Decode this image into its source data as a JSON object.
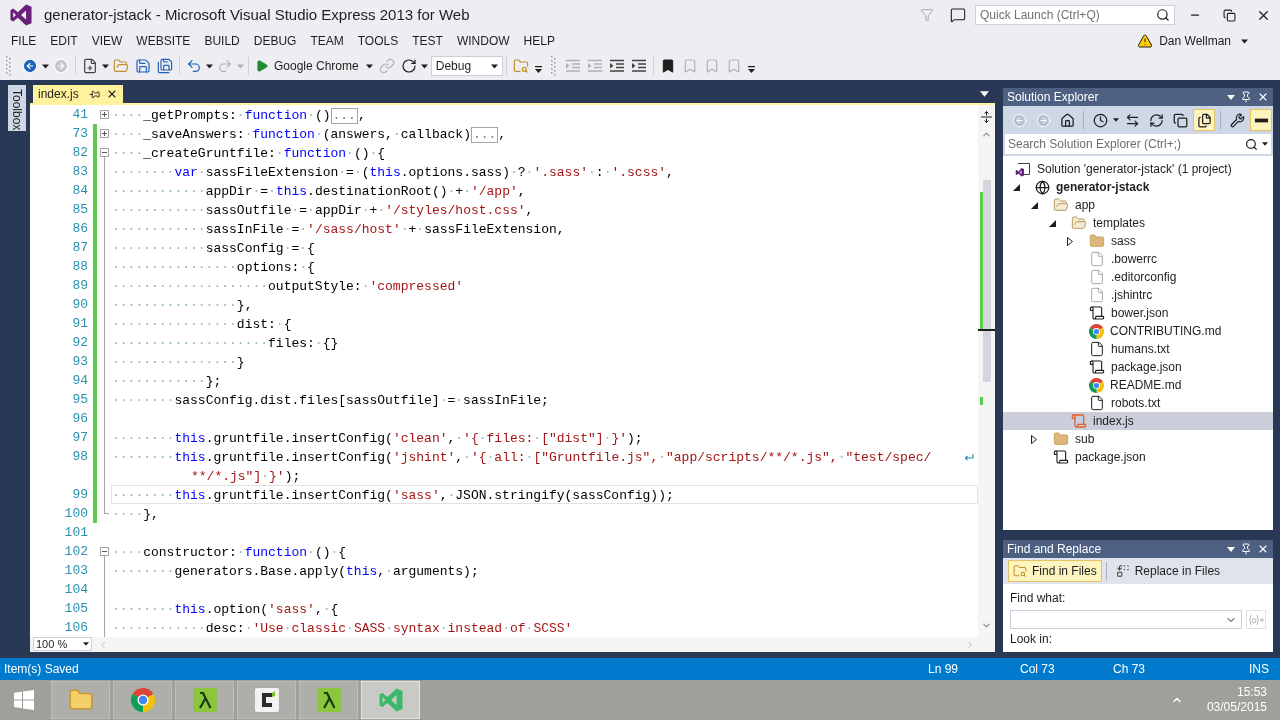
{
  "window": {
    "title": "generator-jstack - Microsoft Visual Studio Express 2013 for Web",
    "quick_launch": {
      "placeholder": "Quick Launch (Ctrl+Q)"
    }
  },
  "menu": [
    "FILE",
    "EDIT",
    "VIEW",
    "WEBSITE",
    "BUILD",
    "DEBUG",
    "TEAM",
    "TOOLS",
    "TEST",
    "WINDOW",
    "HELP"
  ],
  "account": {
    "name": "Dan Wellman",
    "warning": true
  },
  "toolbar": [
    {
      "kind": "back",
      "disabled": false
    },
    {
      "kind": "forward",
      "disabled": true
    },
    {
      "kind": "new-project",
      "disabled": false
    },
    {
      "kind": "open",
      "disabled": false
    },
    {
      "kind": "save",
      "disabled": false
    },
    {
      "kind": "save-all",
      "disabled": false
    },
    {
      "kind": "undo",
      "disabled": false
    },
    {
      "kind": "redo",
      "disabled": true
    },
    {
      "kind": "run",
      "label": "Google Chrome"
    },
    {
      "kind": "browser-link",
      "disabled": true
    },
    {
      "kind": "refresh",
      "disabled": false
    },
    {
      "kind": "select",
      "value": "Debug"
    },
    {
      "kind": "find-in-files",
      "disabled": false
    },
    {
      "kind": "indent-less",
      "disabled": true
    },
    {
      "kind": "indent-more",
      "disabled": true
    },
    {
      "kind": "comment",
      "disabled": false
    },
    {
      "kind": "uncomment",
      "disabled": false
    },
    {
      "kind": "bookmark",
      "disabled": false
    },
    {
      "kind": "bookmark-prev",
      "disabled": true
    },
    {
      "kind": "bookmark-next",
      "disabled": true
    },
    {
      "kind": "bookmark-clear",
      "disabled": true
    }
  ],
  "toolbox": {
    "label": "Toolbox"
  },
  "editor": {
    "tab": {
      "label": "index.js",
      "selected": true
    },
    "lines": [
      {
        "number": "41",
        "expanded": false,
        "changed": false,
        "current": false,
        "tokens": [
          {
            "kind": "plain",
            "text": "····_getPrompts:·"
          },
          {
            "kind": "keyword",
            "text": "function"
          },
          {
            "kind": "plain",
            "text": "·()"
          },
          {
            "kind": "collapsed",
            "text": "..."
          },
          {
            "kind": "plain",
            "text": ","
          }
        ]
      },
      {
        "number": "73",
        "expanded": false,
        "changed": true,
        "current": false,
        "tokens": [
          {
            "kind": "plain",
            "text": "····_saveAnswers:·"
          },
          {
            "kind": "keyword",
            "text": "function"
          },
          {
            "kind": "plain",
            "text": "·(answers,·callback)"
          },
          {
            "kind": "collapsed",
            "text": "..."
          },
          {
            "kind": "plain",
            "text": ","
          }
        ]
      },
      {
        "number": "82",
        "expanded": true,
        "changed": true,
        "current": false,
        "tokens": [
          {
            "kind": "plain",
            "text": "····_createGruntfile:·"
          },
          {
            "kind": "keyword",
            "text": "function"
          },
          {
            "kind": "plain",
            "text": "·()·{"
          }
        ],
        "children": [
          {
            "number": "83",
            "changed": true,
            "current": false,
            "tokens": [
              {
                "kind": "plain",
                "text": "········"
              },
              {
                "kind": "keyword",
                "text": "var"
              },
              {
                "kind": "plain",
                "text": "·sassFileExtension·=·("
              },
              {
                "kind": "keyword",
                "text": "this"
              },
              {
                "kind": "plain",
                "text": ".options.sass)·?·"
              },
              {
                "kind": "string",
                "text": "'.sass'"
              },
              {
                "kind": "plain",
                "text": "·:·"
              },
              {
                "kind": "string",
                "text": "'.scss'"
              },
              {
                "kind": "plain",
                "text": ","
              }
            ]
          },
          {
            "number": "84",
            "changed": true,
            "current": false,
            "tokens": [
              {
                "kind": "plain",
                "text": "············appDir·=·"
              },
              {
                "kind": "keyword",
                "text": "this"
              },
              {
                "kind": "plain",
                "text": ".destinationRoot()·+·"
              },
              {
                "kind": "string",
                "text": "'/app'"
              },
              {
                "kind": "plain",
                "text": ","
              }
            ]
          },
          {
            "number": "85",
            "changed": true,
            "current": false,
            "tokens": [
              {
                "kind": "plain",
                "text": "············sassOutfile·=·appDir·+·"
              },
              {
                "kind": "string",
                "text": "'/styles/host.css'"
              },
              {
                "kind": "plain",
                "text": ","
              }
            ]
          },
          {
            "number": "86",
            "changed": true,
            "current": false,
            "tokens": [
              {
                "kind": "plain",
                "text": "············sassInFile·=·"
              },
              {
                "kind": "string",
                "text": "'/sass/host'"
              },
              {
                "kind": "plain",
                "text": "·+·sassFileExtension,"
              }
            ]
          },
          {
            "number": "87",
            "changed": true,
            "current": false,
            "tokens": [
              {
                "kind": "plain",
                "text": "············sassConfig·=·{"
              }
            ]
          },
          {
            "number": "88",
            "changed": true,
            "current": false,
            "tokens": [
              {
                "kind": "plain",
                "text": "················options:·{"
              }
            ]
          },
          {
            "number": "89",
            "changed": true,
            "current": false,
            "tokens": [
              {
                "kind": "plain",
                "text": "····················outputStyle:·"
              },
              {
                "kind": "string",
                "text": "'compressed'"
              }
            ]
          },
          {
            "number": "90",
            "changed": true,
            "current": false,
            "tokens": [
              {
                "kind": "plain",
                "text": "················},"
              }
            ]
          },
          {
            "number": "91",
            "changed": true,
            "current": false,
            "tokens": [
              {
                "kind": "plain",
                "text": "················dist:·{"
              }
            ]
          },
          {
            "number": "92",
            "changed": true,
            "current": false,
            "tokens": [
              {
                "kind": "plain",
                "text": "····················files:·{}"
              }
            ]
          },
          {
            "number": "93",
            "changed": true,
            "current": false,
            "tokens": [
              {
                "kind": "plain",
                "text": "················}"
              }
            ]
          },
          {
            "number": "94",
            "changed": true,
            "current": false,
            "tokens": [
              {
                "kind": "plain",
                "text": "············};"
              }
            ]
          },
          {
            "number": "95",
            "changed": true,
            "current": false,
            "tokens": [
              {
                "kind": "plain",
                "text": "········sassConfig.dist.files[sassOutfile]·=·sassInFile;"
              }
            ]
          },
          {
            "number": "96",
            "changed": true,
            "current": false
          },
          {
            "number": "97",
            "changed": true,
            "current": false,
            "tokens": [
              {
                "kind": "plain",
                "text": "········"
              },
              {
                "kind": "keyword",
                "text": "this"
              },
              {
                "kind": "plain",
                "text": ".gruntfile.insertConfig("
              },
              {
                "kind": "string",
                "text": "'clean'"
              },
              {
                "kind": "plain",
                "text": ",·"
              },
              {
                "kind": "string",
                "text": "'{·files:·[\"dist\"]·}'"
              },
              {
                "kind": "plain",
                "text": ");"
              }
            ]
          },
          {
            "number": "98",
            "changed": true,
            "current": false,
            "tokens": [
              {
                "kind": "plain",
                "text": "········"
              },
              {
                "kind": "keyword",
                "text": "this"
              },
              {
                "kind": "plain",
                "text": ".gruntfile.insertConfig("
              },
              {
                "kind": "string",
                "text": "'jshint'"
              },
              {
                "kind": "plain",
                "text": ",·"
              },
              {
                "kind": "string",
                "text": "'{·all:·[\"Gruntfile.js\",·\"app/scripts/**/*.js\",·\"test/spec/"
              }
            ],
            "wrap": [
              {
                "kind": "string",
                "text": "**/*.js\"]·}'"
              },
              {
                "kind": "plain",
                "text": ");"
              }
            ]
          },
          {
            "number": "99",
            "changed": true,
            "current": true,
            "tokens": [
              {
                "kind": "plain",
                "text": "········"
              },
              {
                "kind": "keyword",
                "text": "this"
              },
              {
                "kind": "plain",
                "text": ".gruntfile.insertConfig("
              },
              {
                "kind": "string",
                "text": "'sass'"
              },
              {
                "kind": "plain",
                "text": ",·JSON.stringify(sassConfig));"
              }
            ]
          },
          {
            "number": "100",
            "changed": true,
            "current": false,
            "tokens": [
              {
                "kind": "plain",
                "text": "····},"
              }
            ]
          }
        ]
      },
      {
        "number": "101",
        "changed": false,
        "current": false
      },
      {
        "number": "102",
        "expanded": true,
        "changed": false,
        "current": false,
        "tokens": [
          {
            "kind": "plain",
            "text": "····constructor:·"
          },
          {
            "kind": "keyword",
            "text": "function"
          },
          {
            "kind": "plain",
            "text": "·()·{"
          }
        ],
        "children": [
          {
            "number": "103",
            "changed": false,
            "current": false,
            "tokens": [
              {
                "kind": "plain",
                "text": "········generators.Base.apply("
              },
              {
                "kind": "keyword",
                "text": "this"
              },
              {
                "kind": "plain",
                "text": ",·arguments);"
              }
            ]
          },
          {
            "number": "104",
            "changed": false,
            "current": false
          },
          {
            "number": "105",
            "changed": false,
            "current": false,
            "tokens": [
              {
                "kind": "plain",
                "text": "········"
              },
              {
                "kind": "keyword",
                "text": "this"
              },
              {
                "kind": "plain",
                "text": ".option("
              },
              {
                "kind": "string",
                "text": "'sass'"
              },
              {
                "kind": "plain",
                "text": ",·{"
              }
            ]
          },
          {
            "number": "106",
            "changed": false,
            "current": false,
            "tokens": [
              {
                "kind": "plain",
                "text": "············desc:·"
              },
              {
                "kind": "string",
                "text": "'Use·classic·SASS·syntax·instead·of·SCSS'"
              }
            ]
          }
        ]
      }
    ],
    "zoom": "100 %"
  },
  "solution_explorer": {
    "title": "Solution Explorer",
    "toolbar": [
      {
        "kind": "back",
        "disabled": true,
        "pressed": false
      },
      {
        "kind": "forward",
        "disabled": true,
        "pressed": false
      },
      {
        "kind": "home",
        "disabled": false,
        "pressed": false
      },
      {
        "kind": "pending-changes",
        "disabled": false,
        "pressed": false
      },
      {
        "kind": "sync",
        "disabled": false,
        "pressed": false
      },
      {
        "kind": "refresh",
        "disabled": false,
        "pressed": false
      },
      {
        "kind": "collapse-all",
        "disabled": false,
        "pressed": false
      },
      {
        "kind": "show-all-files",
        "disabled": false,
        "pressed": true
      },
      {
        "kind": "properties",
        "disabled": false,
        "pressed": false
      },
      {
        "kind": "preview",
        "disabled": false,
        "pressed": true
      }
    ],
    "search": {
      "placeholder": "Search Solution Explorer (Ctrl+;)"
    },
    "tree": [
      {
        "label": "Solution 'generator-jstack' (1 project)",
        "kind": "solution",
        "selected": false,
        "children": [
          {
            "label": "generator-jstack",
            "kind": "project",
            "expanded": true,
            "selected": false,
            "children": [
              {
                "label": "app",
                "kind": "folder",
                "expanded": true,
                "selected": false,
                "children": [
                  {
                    "label": "templates",
                    "kind": "folder",
                    "expanded": true,
                    "selected": false,
                    "children": [
                      {
                        "label": "sass",
                        "kind": "folder",
                        "expanded": false,
                        "selected": false
                      },
                      {
                        "label": ".bowerrc",
                        "kind": "file",
                        "selected": false
                      },
                      {
                        "label": ".editorconfig",
                        "kind": "file",
                        "selected": false
                      },
                      {
                        "label": ".jshintrc",
                        "kind": "file",
                        "selected": false
                      },
                      {
                        "label": "bower.json",
                        "kind": "json",
                        "selected": false
                      },
                      {
                        "label": "CONTRIBUTING.md",
                        "kind": "markdown",
                        "selected": false
                      },
                      {
                        "label": "humans.txt",
                        "kind": "text",
                        "selected": false
                      },
                      {
                        "label": "package.json",
                        "kind": "json",
                        "selected": false
                      },
                      {
                        "label": "README.md",
                        "kind": "markdown",
                        "selected": false
                      },
                      {
                        "label": "robots.txt",
                        "kind": "text",
                        "selected": false
                      }
                    ]
                  },
                  {
                    "label": "index.js",
                    "kind": "js",
                    "selected": true
                  }
                ]
              },
              {
                "label": "sub",
                "kind": "folder",
                "expanded": false,
                "selected": false
              },
              {
                "label": "package.json",
                "kind": "json",
                "selected": false
              }
            ]
          }
        ]
      }
    ]
  },
  "find_and_replace": {
    "title": "Find and Replace",
    "tabs": [
      {
        "kind": "find",
        "label": "Find in Files",
        "selected": true
      },
      {
        "kind": "replace",
        "label": "Replace in Files",
        "selected": false
      }
    ],
    "find_what": {
      "label": "Find what:",
      "builder_disabled": true
    },
    "look_in": {
      "label": "Look in:"
    }
  },
  "status_bar": {
    "message": "Item(s) Saved",
    "line": "Ln 99",
    "column": "Col 73",
    "char": "Ch 73",
    "mode": "INS"
  },
  "taskbar": {
    "apps": [
      {
        "kind": "explorer",
        "selected": false
      },
      {
        "kind": "chrome",
        "selected": false
      },
      {
        "kind": "lambda",
        "selected": false
      },
      {
        "kind": "c-logo",
        "selected": false
      },
      {
        "kind": "lambda",
        "selected": false
      },
      {
        "kind": "visual-studio",
        "selected": true
      }
    ],
    "clock": {
      "time": "15:53",
      "date": "03/05/2015"
    }
  }
}
